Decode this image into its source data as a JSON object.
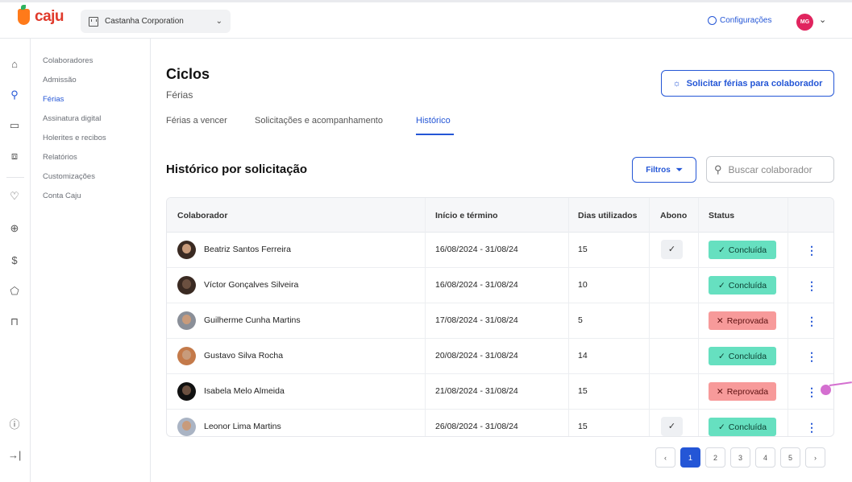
{
  "header": {
    "logo_text": "caju",
    "company": "Castanha Corporation",
    "company_chevron": "chevron-down",
    "config_label": "Configurações",
    "user_initials": "MG"
  },
  "rail_icons": [
    "home-icon",
    "users-icon",
    "card-icon",
    "dollar-box-icon",
    "heart-icon",
    "gift-icon",
    "dollar-icon",
    "tag-icon",
    "bag-icon",
    "help-icon",
    "collapse-icon"
  ],
  "subnav": {
    "items": [
      {
        "label": "Colaboradores",
        "active": false
      },
      {
        "label": "Admissão",
        "active": false
      },
      {
        "label": "Férias",
        "active": true
      },
      {
        "label": "Assinatura digital",
        "active": false
      },
      {
        "label": "Holerites e recibos",
        "active": false
      },
      {
        "label": "Relatórios",
        "active": false
      },
      {
        "label": "Customizações",
        "active": false
      },
      {
        "label": "Conta Caju",
        "active": false
      }
    ]
  },
  "page": {
    "title": "Ciclos",
    "subtitle": "Férias",
    "request_button": "Solicitar férias para colaborador",
    "tabs": [
      {
        "label": "Férias a vencer",
        "active": false
      },
      {
        "label": "Solicitações e acompanhamento",
        "active": false
      },
      {
        "label": "Histórico",
        "active": true
      }
    ],
    "section_title": "Histórico por solicitação",
    "filters_button": "Filtros",
    "search_placeholder": "Buscar colaborador"
  },
  "table": {
    "headers": [
      "Colaborador",
      "Início e término",
      "Dias utilizados",
      "Abono",
      "Status"
    ],
    "rows": [
      {
        "name": "Beatriz Santos Ferreira",
        "period": "16/08/2024 - 31/08/24",
        "days": "15",
        "abono": true,
        "status": "Concluída",
        "status_ok": true
      },
      {
        "name": "Víctor Gonçalves Silveira",
        "period": "16/08/2024 - 31/08/24",
        "days": "10",
        "abono": false,
        "status": "Concluída",
        "status_ok": true
      },
      {
        "name": "Guilherme Cunha Martins",
        "period": "17/08/2024 - 31/08/24",
        "days": "5",
        "abono": false,
        "status": "Reprovada",
        "status_ok": false
      },
      {
        "name": "Gustavo Silva Rocha",
        "period": "20/08/2024 - 31/08/24",
        "days": "14",
        "abono": false,
        "status": "Concluída",
        "status_ok": true
      },
      {
        "name": "Isabela Melo Almeida",
        "period": "21/08/2024 - 31/08/24",
        "days": "15",
        "abono": false,
        "status": "Reprovada",
        "status_ok": false
      },
      {
        "name": "Leonor Lima Martins",
        "period": "26/08/2024 - 31/08/24",
        "days": "15",
        "abono": true,
        "status": "Concluída",
        "status_ok": true
      }
    ]
  },
  "pagination": {
    "pages": [
      "1",
      "2",
      "3",
      "4",
      "5"
    ],
    "current": "1"
  },
  "colors": {
    "accent": "#2456d6",
    "success": "#66e0c0",
    "danger": "#f79a9a",
    "brand": "#e03a2b"
  }
}
